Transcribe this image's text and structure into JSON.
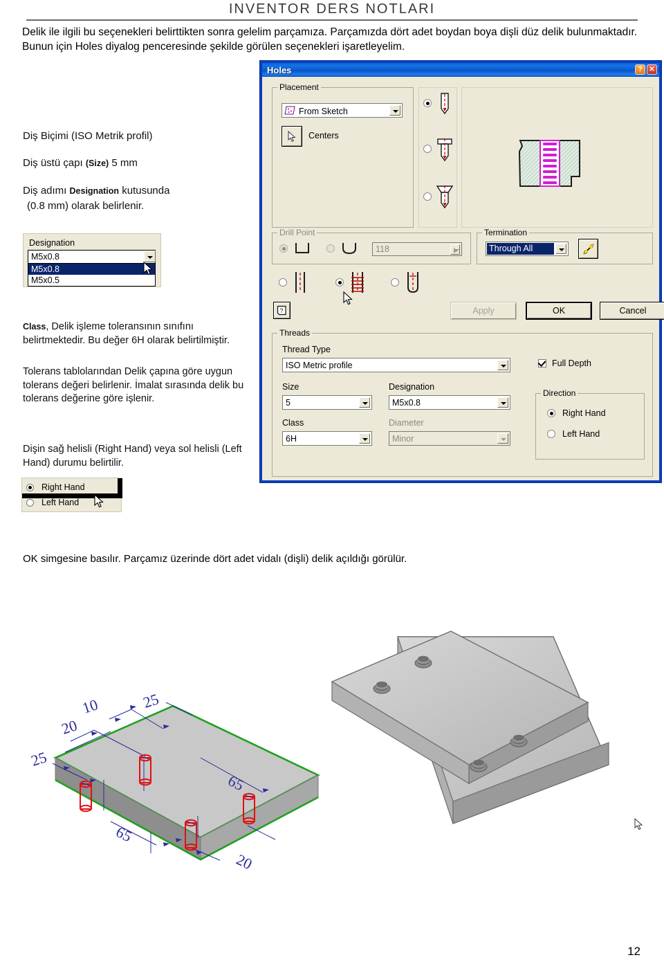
{
  "header": {
    "title": "INVENTOR DERS NOTLARI"
  },
  "intro": "Delik ile ilgili bu seçenekleri belirttikten sonra gelelim parçamıza. Parçamızda dört adet boydan boya dişli düz delik bulunmaktadır. Bunun için Holes diyalog penceresinde şekilde görülen seçenekleri işaretleyelim.",
  "notes": {
    "thread_form": "Diş Biçimi (ISO Metrik profil)",
    "major_diameter_pre": "Diş üstü çapı ",
    "major_diameter_bold": "(Size)",
    "major_diameter_post": " 5 mm",
    "pitch_line1_pre": "Diş adımı ",
    "pitch_line1_bold": "Designation",
    "pitch_line1_post": " kutusunda",
    "pitch_line2": "(0.8 mm) olarak belirlenir.",
    "class_bold": "Class",
    "class_text": ", Delik işleme toleransının sınıfını belirtmektedir. Bu değer 6H olarak belirtilmiştir.",
    "tolerance_text": "Tolerans tablolarından Delik çapına göre uygun tolerans değeri belirlenir. İmalat sırasında delik bu tolerans değerine göre işlenir.",
    "hand_text": "Dişin sağ helisli (Right Hand) veya sol helisli (Left Hand) durumu belirtilir.",
    "closing": "OK simgesine basılır. Parçamız üzerinde dört adet vidalı (dişli) delik açıldığı görülür."
  },
  "inset_designation": {
    "label": "Designation",
    "value": "M5x0.8",
    "options": [
      "M5x0.8",
      "M5x0.5"
    ],
    "selected_index": 0
  },
  "inset_direction": {
    "options": [
      "Right Hand",
      "Left Hand"
    ],
    "selected": "Right Hand"
  },
  "dialog": {
    "title": "Holes",
    "titlebar_buttons": {
      "help": "?",
      "close": "✕"
    },
    "placement": {
      "group_label": "Placement",
      "type_value": "From Sketch",
      "centers_label": "Centers",
      "centers_icon": "select-arrow-icon"
    },
    "hole_type": {
      "options": [
        "simple-hole-icon",
        "counterbore-hole-icon",
        "countersink-hole-icon"
      ],
      "selected_index": 0
    },
    "drill_point": {
      "group_label": "Drill Point",
      "options": [
        "flat-drill-point-icon",
        "angle-drill-point-icon"
      ],
      "selected_index": 0,
      "angle_value": "118",
      "disabled": true
    },
    "termination": {
      "group_label": "Termination",
      "value": "Through All",
      "flip_icon": "flip-direction-icon"
    },
    "bottom_type": {
      "options": [
        "drilled-hole-icon",
        "tapped-hole-icon",
        "taper-tapped-hole-icon"
      ],
      "selected_index": 1
    },
    "threads": {
      "group_label": "Threads",
      "thread_type_label": "Thread Type",
      "thread_type_value": "ISO Metric profile",
      "size_label": "Size",
      "size_value": "5",
      "designation_label": "Designation",
      "designation_value": "M5x0.8",
      "class_label": "Class",
      "class_value": "6H",
      "diameter_label": "Diameter",
      "diameter_value": "Minor",
      "diameter_disabled": true,
      "full_depth_label": "Full Depth",
      "full_depth_checked": true,
      "direction_label": "Direction",
      "direction_options": [
        "Right Hand",
        "Left Hand"
      ],
      "direction_selected": "Right Hand"
    },
    "buttons": {
      "help": "?",
      "apply": "Apply",
      "apply_disabled": true,
      "ok": "OK",
      "cancel": "Cancel"
    }
  },
  "figure": {
    "sketch_dimensions": [
      "10",
      "20",
      "25",
      "25",
      "65",
      "65",
      "20"
    ],
    "hole_count": 4
  },
  "footer": {
    "page_number": "12"
  }
}
